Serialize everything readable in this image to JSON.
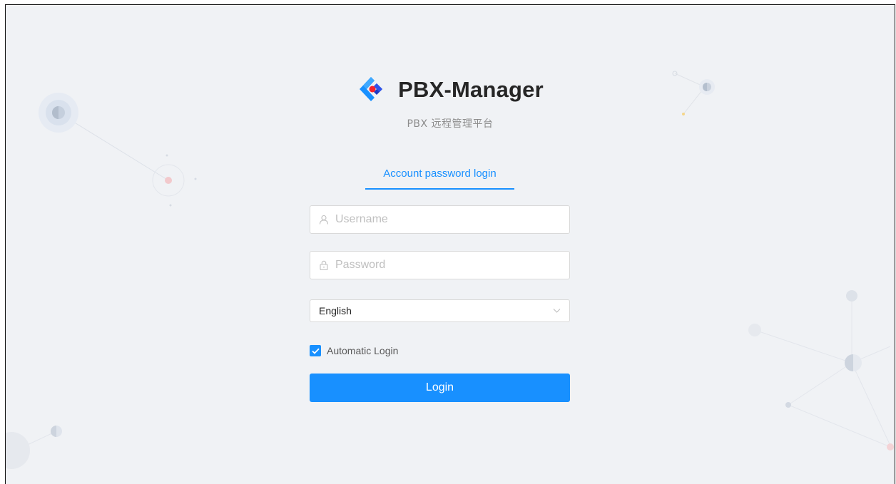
{
  "brand": {
    "title": "PBX-Manager",
    "subtitle": "PBX 远程管理平台",
    "logo_icon": "diamond-logo-icon"
  },
  "login_tab": {
    "label": "Account password login"
  },
  "username": {
    "placeholder": "Username",
    "value": "",
    "icon": "user-icon"
  },
  "password": {
    "placeholder": "Password",
    "value": "",
    "icon": "lock-icon"
  },
  "language": {
    "selected": "English",
    "icon": "chevron-down-icon"
  },
  "auto_login": {
    "label": "Automatic Login",
    "checked": true
  },
  "login_button": {
    "label": "Login"
  },
  "colors": {
    "primary": "#1890ff",
    "background": "#f0f2f5",
    "logo_red": "#f5222d"
  }
}
